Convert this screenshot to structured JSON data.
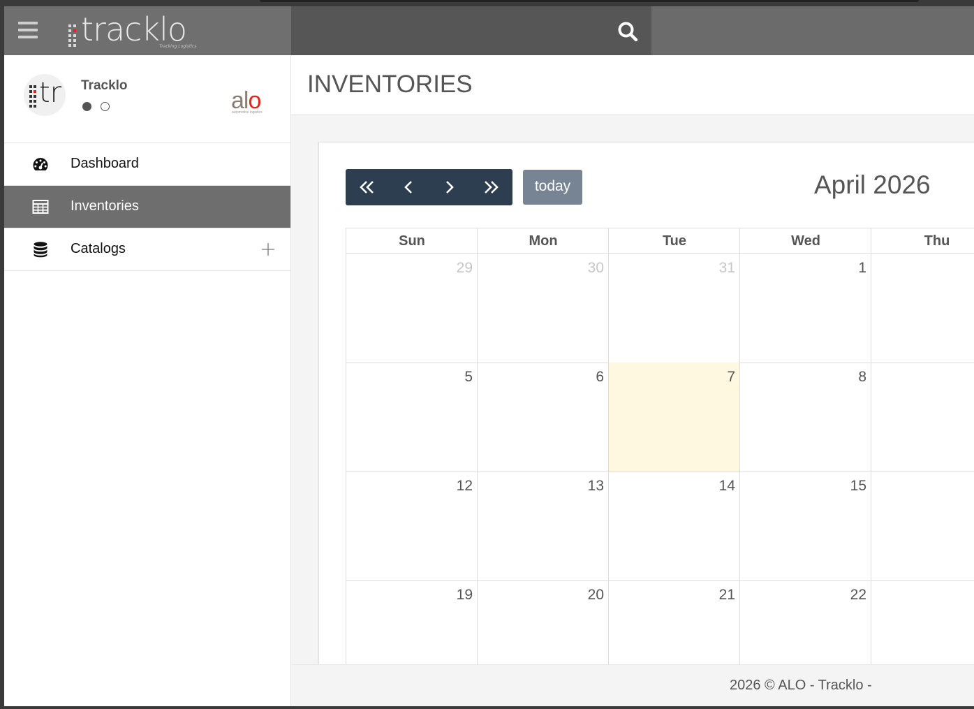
{
  "app": {
    "logo_text": "tracklo",
    "logo_tagline": "Tracking Logistics"
  },
  "profile": {
    "name": "Tracklo",
    "avatar_text": "tr",
    "partner_logo": "alo",
    "partner_tagline": "automotive logistics"
  },
  "nav": {
    "items": [
      {
        "label": "Dashboard",
        "icon": "dashboard-gauge-icon"
      },
      {
        "label": "Inventories",
        "icon": "table-grid-icon"
      },
      {
        "label": "Catalogs",
        "icon": "database-icon"
      }
    ]
  },
  "page": {
    "title": "INVENTORIES"
  },
  "calendar": {
    "today_label": "today",
    "month_title": "April 2026",
    "weekdays": [
      "Sun",
      "Mon",
      "Tue",
      "Wed",
      "Thu"
    ],
    "weeks": [
      [
        {
          "d": "29",
          "other": true
        },
        {
          "d": "30",
          "other": true
        },
        {
          "d": "31",
          "other": true
        },
        {
          "d": "1"
        },
        {
          "d": ""
        }
      ],
      [
        {
          "d": "5"
        },
        {
          "d": "6"
        },
        {
          "d": "7",
          "today": true
        },
        {
          "d": "8"
        },
        {
          "d": ""
        }
      ],
      [
        {
          "d": "12"
        },
        {
          "d": "13"
        },
        {
          "d": "14"
        },
        {
          "d": "15"
        },
        {
          "d": ""
        }
      ],
      [
        {
          "d": "19"
        },
        {
          "d": "20"
        },
        {
          "d": "21"
        },
        {
          "d": "22"
        },
        {
          "d": ""
        }
      ]
    ]
  },
  "footer": {
    "text": "2026 © ALO - Tracklo -"
  },
  "colors": {
    "topbar": "#6b6b6b",
    "nav_active": "#6e6e6e",
    "calendar_buttons": "#2c3e50",
    "today_button": "#778494",
    "today_cell": "#fdf8df",
    "partner_red": "#e0261e"
  }
}
